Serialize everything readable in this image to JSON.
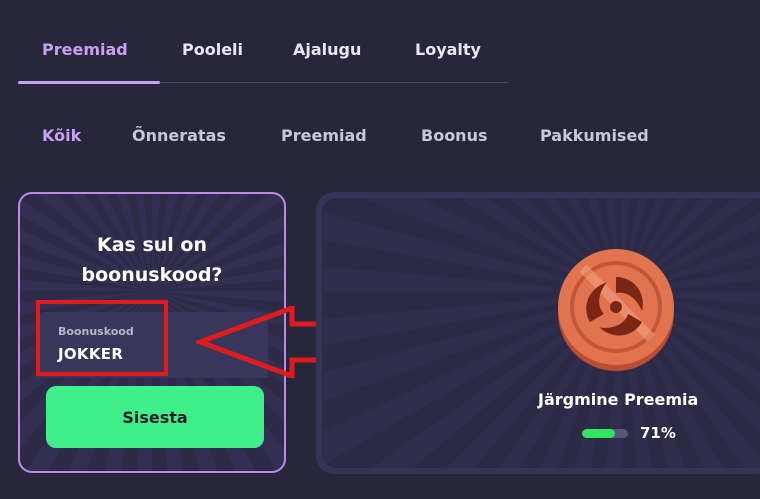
{
  "tabs": {
    "main": [
      "Preemiad",
      "Pooleli",
      "Ajalugu",
      "Loyalty"
    ],
    "active_main": 0,
    "sub": [
      "Kõik",
      "Õnneratas",
      "Preemiad",
      "Boonus",
      "Pakkumised"
    ],
    "active_sub": 0
  },
  "bonus": {
    "title": "Kas sul on boonuskood?",
    "field_label": "Boonuskood",
    "field_value": "JOKKER",
    "submit_label": "Sisesta"
  },
  "reward": {
    "label": "Järgmine Preemia",
    "progress_fraction": 0.71,
    "progress_text": "71%"
  },
  "colors": {
    "accent": "#c7a0f2",
    "button": "#3ff08a",
    "highlight": "#e01b1b",
    "progress": "#35e561"
  }
}
